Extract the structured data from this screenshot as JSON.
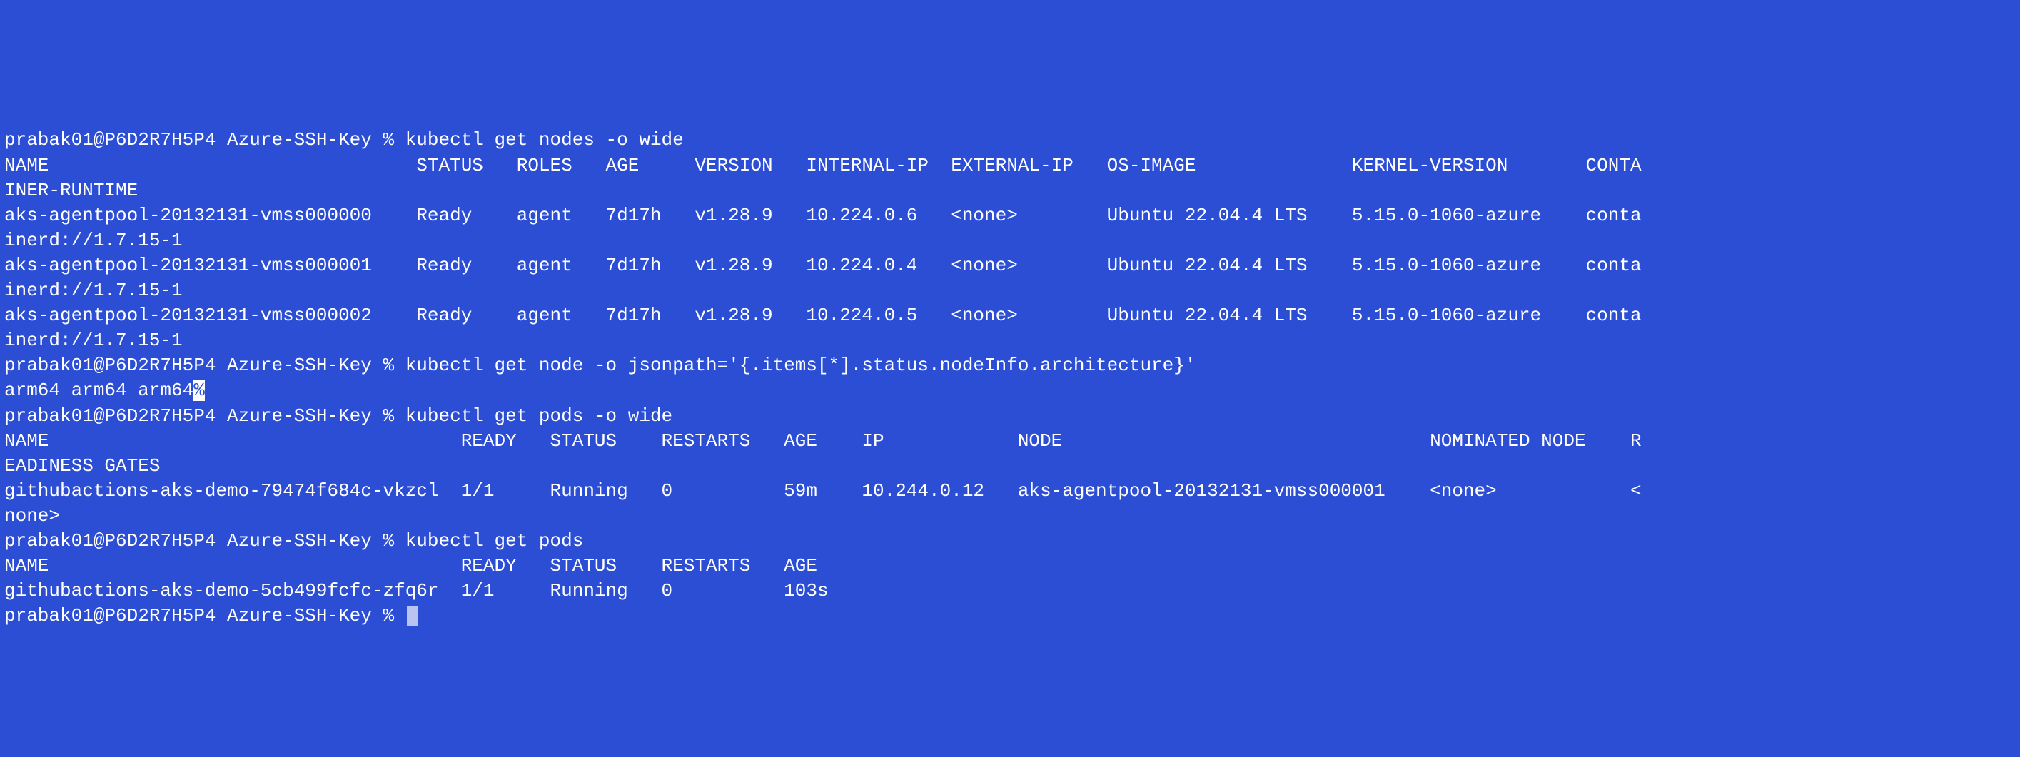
{
  "prompt": {
    "user": "prabak01",
    "host": "P6D2R7H5P4",
    "dir": "Azure-SSH-Key",
    "sep": "%"
  },
  "commands": {
    "get_nodes_wide": "kubectl get nodes -o wide",
    "get_arch": "kubectl get node -o jsonpath='{.items[*].status.nodeInfo.architecture}'",
    "get_pods_wide": "kubectl get pods -o wide",
    "get_pods": "kubectl get pods"
  },
  "nodes_header": {
    "name": "NAME",
    "status": "STATUS",
    "roles": "ROLES",
    "age": "AGE",
    "version": "VERSION",
    "internal_ip": "INTERNAL-IP",
    "external_ip": "EXTERNAL-IP",
    "os_image": "OS-IMAGE",
    "kernel": "KERNEL-VERSION",
    "runtime": "CONTAINER-RUNTIME"
  },
  "nodes": [
    {
      "name": "aks-agentpool-20132131-vmss000000",
      "status": "Ready",
      "roles": "agent",
      "age": "7d17h",
      "version": "v1.28.9",
      "internal_ip": "10.224.0.6",
      "external_ip": "<none>",
      "os_image": "Ubuntu 22.04.4 LTS",
      "kernel": "5.15.0-1060-azure",
      "runtime": "containerd://1.7.15-1"
    },
    {
      "name": "aks-agentpool-20132131-vmss000001",
      "status": "Ready",
      "roles": "agent",
      "age": "7d17h",
      "version": "v1.28.9",
      "internal_ip": "10.224.0.4",
      "external_ip": "<none>",
      "os_image": "Ubuntu 22.04.4 LTS",
      "kernel": "5.15.0-1060-azure",
      "runtime": "containerd://1.7.15-1"
    },
    {
      "name": "aks-agentpool-20132131-vmss000002",
      "status": "Ready",
      "roles": "agent",
      "age": "7d17h",
      "version": "v1.28.9",
      "internal_ip": "10.224.0.5",
      "external_ip": "<none>",
      "os_image": "Ubuntu 22.04.4 LTS",
      "kernel": "5.15.0-1060-azure",
      "runtime": "containerd://1.7.15-1"
    }
  ],
  "arch_output": {
    "text": "arm64 arm64 arm64",
    "tail_char": "%"
  },
  "pods_wide_header": {
    "name": "NAME",
    "ready": "READY",
    "status": "STATUS",
    "restarts": "RESTARTS",
    "age": "AGE",
    "ip": "IP",
    "node": "NODE",
    "nominated": "NOMINATED NODE",
    "readiness": "READINESS GATES"
  },
  "pods_wide": [
    {
      "name": "githubactions-aks-demo-79474f684c-vkzcl",
      "ready": "1/1",
      "status": "Running",
      "restarts": "0",
      "age": "59m",
      "ip": "10.244.0.12",
      "node": "aks-agentpool-20132131-vmss000001",
      "nominated": "<none>",
      "readiness": "<none>"
    }
  ],
  "pods_header": {
    "name": "NAME",
    "ready": "READY",
    "status": "STATUS",
    "restarts": "RESTARTS",
    "age": "AGE"
  },
  "pods": [
    {
      "name": "githubactions-aks-demo-5cb499fcfc-zfq6r",
      "ready": "1/1",
      "status": "Running",
      "restarts": "0",
      "age": "103s"
    }
  ]
}
